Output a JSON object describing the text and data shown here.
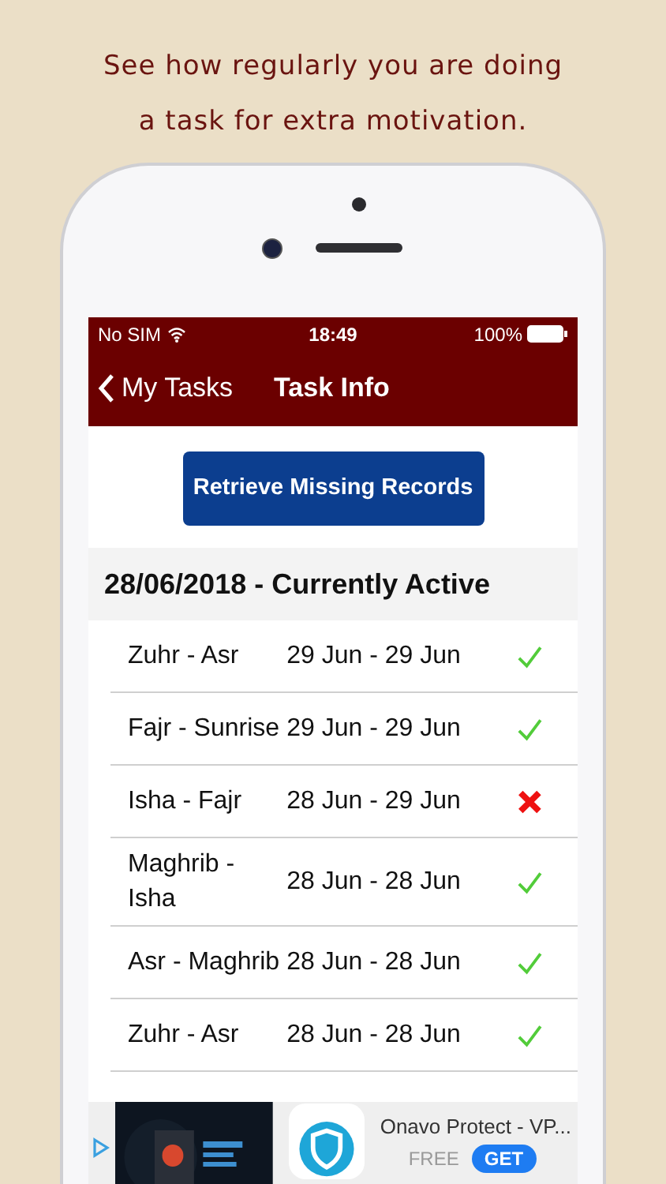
{
  "caption": [
    "See how regularly you are doing",
    "a task for extra motivation."
  ],
  "status_bar": {
    "carrier": "No SIM",
    "time": "18:49",
    "battery": "100%"
  },
  "nav": {
    "back": "My Tasks",
    "title": "Task Info"
  },
  "action_button": "Retrieve Missing Records",
  "section": {
    "title": "28/06/2018 - Currently Active"
  },
  "records": [
    {
      "name": "Zuhr - Asr",
      "dates": "29 Jun - 29 Jun",
      "done": true
    },
    {
      "name": "Fajr - Sunrise",
      "dates": "29 Jun - 29 Jun",
      "done": true
    },
    {
      "name": "Isha - Fajr",
      "dates": "28 Jun - 29 Jun",
      "done": false
    },
    {
      "name": "Maghrib - Isha",
      "dates": "28 Jun - 28 Jun",
      "done": true
    },
    {
      "name": "Asr - Maghrib",
      "dates": "28 Jun - 28 Jun",
      "done": true
    },
    {
      "name": "Zuhr - Asr",
      "dates": "28 Jun - 28 Jun",
      "done": true
    }
  ],
  "ad": {
    "title": "Onavo Protect - VP...",
    "price": "FREE",
    "button": "GET"
  }
}
